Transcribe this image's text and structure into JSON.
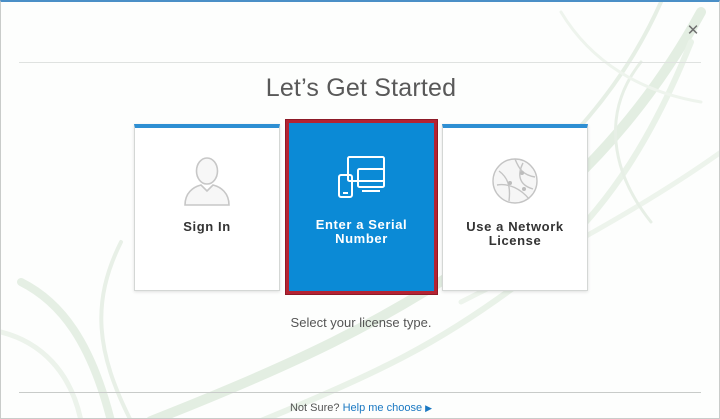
{
  "dialog": {
    "title": "Let’s Get Started",
    "close_icon": "close-icon",
    "subtitle": "Select your license type.",
    "accent_color": "#2e8fd3",
    "selected_color": "#0b8ad6",
    "highlight_border_color": "#b52333"
  },
  "cards": [
    {
      "label": "Sign In",
      "icon": "user-silhouette-icon",
      "selected": false
    },
    {
      "label": "Enter a Serial Number",
      "icon": "devices-icon",
      "selected": true
    },
    {
      "label": "Use a Network License",
      "icon": "network-globe-icon",
      "selected": false
    }
  ],
  "footer": {
    "prompt": "Not Sure?",
    "link_label": "Help me choose",
    "link_icon": "triangle-right-icon"
  }
}
